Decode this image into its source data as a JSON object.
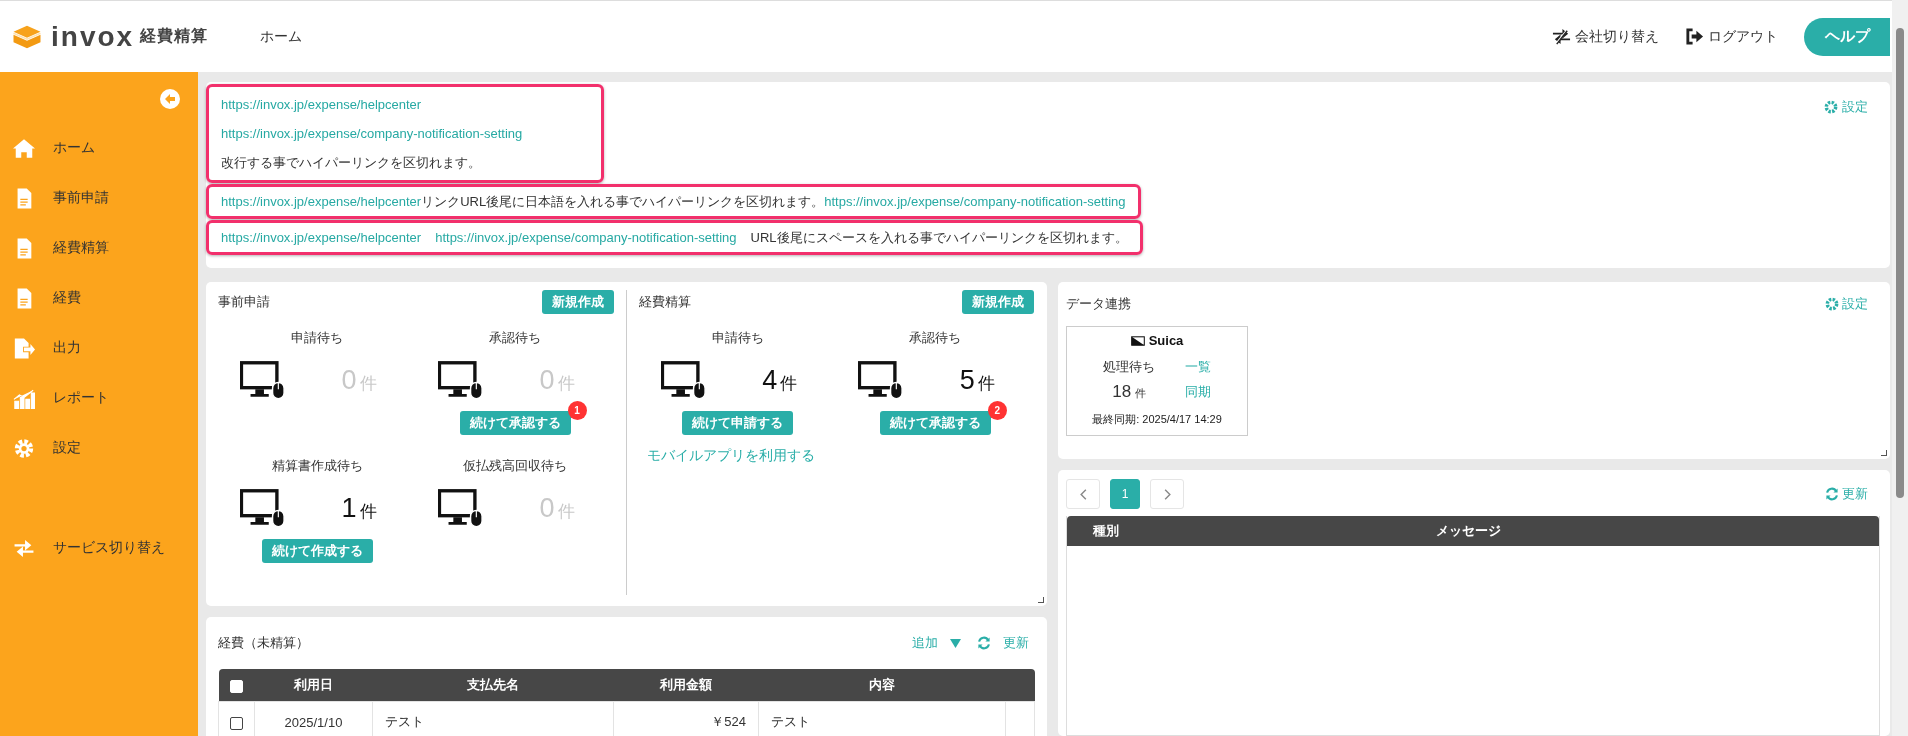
{
  "header": {
    "logo": "invox",
    "product": "経費精算",
    "nav": [
      "ホーム"
    ],
    "company_switch": "会社切り替え",
    "logout": "ログアウト",
    "help": "ヘルプ"
  },
  "sidebar": {
    "items": [
      {
        "label": "ホーム"
      },
      {
        "label": "事前申請"
      },
      {
        "label": "経費精算"
      },
      {
        "label": "経費"
      },
      {
        "label": "出力"
      },
      {
        "label": "レポート"
      },
      {
        "label": "設定"
      }
    ],
    "service_switch": "サービス切り替え"
  },
  "notices": {
    "settings": "設定",
    "blocks": [
      {
        "highlighted": true,
        "lines": [
          [
            {
              "kind": "link",
              "text": "https://invox.jp/expense/helpcenter"
            }
          ],
          [
            {
              "kind": "link",
              "text": "https://invox.jp/expense/company-notification-setting"
            }
          ],
          [
            {
              "kind": "text",
              "text": "改行する事でハイパーリンクを区切れます。"
            }
          ]
        ]
      },
      {
        "highlighted": true,
        "lines": [
          [
            {
              "kind": "link",
              "text": "https://invox.jp/expense/helpcenter"
            },
            {
              "kind": "text",
              "text": "リンクURL後尾に日本語を入れる事でハイパーリンクを区切れます。"
            },
            {
              "kind": "link",
              "text": "https://invox.jp/expense/company-notification-setting"
            }
          ]
        ]
      },
      {
        "highlighted": true,
        "lines": [
          [
            {
              "kind": "link",
              "text": "https://invox.jp/expense/helpcenter"
            },
            {
              "kind": "space"
            },
            {
              "kind": "link",
              "text": "https://invox.jp/expense/company-notification-setting"
            },
            {
              "kind": "space"
            },
            {
              "kind": "text",
              "text": "URL後尾にスペースを入れる事でハイパーリンクを区切れます。"
            }
          ]
        ]
      }
    ]
  },
  "dashboard": {
    "sections": [
      {
        "title": "事前申請",
        "new_button": "新規作成",
        "stats": [
          {
            "label": "申請待ち",
            "count": "0",
            "unit": "件",
            "empty": true
          },
          {
            "label": "承認待ち",
            "count": "0",
            "unit": "件",
            "empty": true,
            "action": "続けて承認する",
            "badge": "1"
          },
          {
            "label": "精算書作成待ち",
            "count": "1",
            "unit": "件",
            "empty": false,
            "action": "続けて作成する"
          },
          {
            "label": "仮払残高回収待ち",
            "count": "0",
            "unit": "件",
            "empty": true
          }
        ]
      },
      {
        "title": "経費精算",
        "new_button": "新規作成",
        "stats": [
          {
            "label": "申請待ち",
            "count": "4",
            "unit": "件",
            "empty": false,
            "action": "続けて申請する"
          },
          {
            "label": "承認待ち",
            "count": "5",
            "unit": "件",
            "empty": false,
            "action": "続けて承認する",
            "badge": "2"
          }
        ],
        "link": "モバイルアプリを利用する"
      }
    ]
  },
  "data_link": {
    "title": "データ連携",
    "settings": "設定",
    "card": {
      "name": "Suica",
      "pending_label": "処理待ち",
      "count": "18",
      "unit": "件",
      "links": [
        "一覧",
        "同期"
      ],
      "last_sync": "最終同期: 2025/4/17 14:29"
    }
  },
  "messages": {
    "pages": [
      {
        "label": "1",
        "selected": true
      }
    ],
    "refresh": "更新",
    "columns": [
      "種別",
      "メッセージ"
    ]
  },
  "expenses": {
    "title": "経費（未精算）",
    "add": "追加",
    "refresh": "更新",
    "all_checked": false,
    "columns": [
      "利用日",
      "支払先名",
      "利用金額",
      "内容"
    ],
    "rows": [
      {
        "checked": false,
        "date": "2025/1/10",
        "payee": "テスト",
        "amount": "￥524",
        "content": "テスト"
      }
    ]
  }
}
